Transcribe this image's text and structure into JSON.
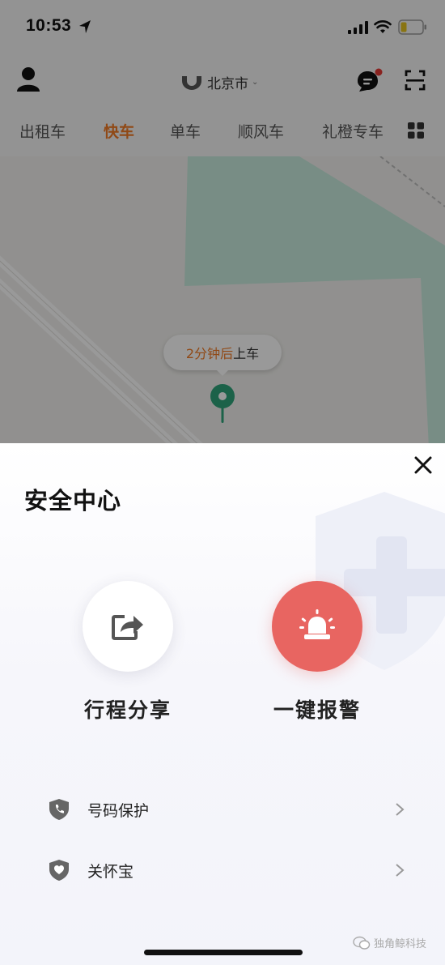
{
  "status_bar": {
    "time": "10:53"
  },
  "header": {
    "city": "北京市"
  },
  "tabs": [
    {
      "label": "出租车",
      "active": false
    },
    {
      "label": "快车",
      "active": true
    },
    {
      "label": "单车",
      "active": false
    },
    {
      "label": "顺风车",
      "active": false
    },
    {
      "label": "礼橙专车",
      "active": false
    }
  ],
  "map": {
    "pickup_eta": "2分钟后",
    "pickup_suffix": "上车"
  },
  "safety_center": {
    "title": "安全中心",
    "actions": [
      {
        "label": "行程分享",
        "icon": "share-icon"
      },
      {
        "label": "一键报警",
        "icon": "alarm-siren-icon"
      }
    ],
    "items": [
      {
        "label": "号码保护",
        "icon": "phone-shield-icon"
      },
      {
        "label": "关怀宝",
        "icon": "care-shield-icon"
      }
    ]
  },
  "watermark": "独角鲸科技",
  "colors": {
    "accent_orange": "#f07b25",
    "alarm_red": "#e86561",
    "pin_green": "#2fa37b"
  }
}
